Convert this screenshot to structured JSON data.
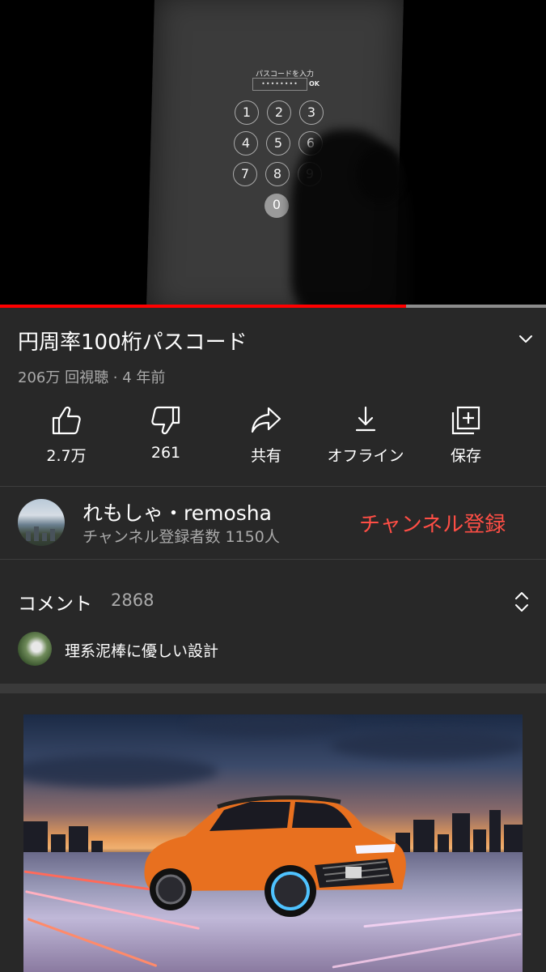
{
  "video": {
    "passcode_label": "パスコードを入力",
    "passcode_mask": "••••••••",
    "ok_label": "OK",
    "keys": [
      "1",
      "2",
      "3",
      "4",
      "5",
      "6",
      "7",
      "8",
      "9",
      "0"
    ],
    "progress_percent": 74.4
  },
  "title": "円周率100桁パスコード",
  "meta": "206万 回視聴 · 4 年前",
  "actions": {
    "like": {
      "label": "2.7万",
      "icon": "thumb-up-icon"
    },
    "dislike": {
      "label": "261",
      "icon": "thumb-down-icon"
    },
    "share": {
      "label": "共有",
      "icon": "share-icon"
    },
    "download": {
      "label": "オフライン",
      "icon": "download-icon"
    },
    "save": {
      "label": "保存",
      "icon": "add-to-playlist-icon"
    }
  },
  "channel": {
    "name": "れもしゃ・remosha",
    "subscribers": "チャンネル登録者数 1150人",
    "subscribe_label": "チャンネル登録"
  },
  "comments": {
    "title": "コメント",
    "count": "2868",
    "top_comment": "理系泥棒に優しい設計"
  },
  "colors": {
    "background": "#282828",
    "accent": "#ff0000",
    "subscribe": "#ff4e45",
    "secondary_text": "#aaaaaa"
  }
}
